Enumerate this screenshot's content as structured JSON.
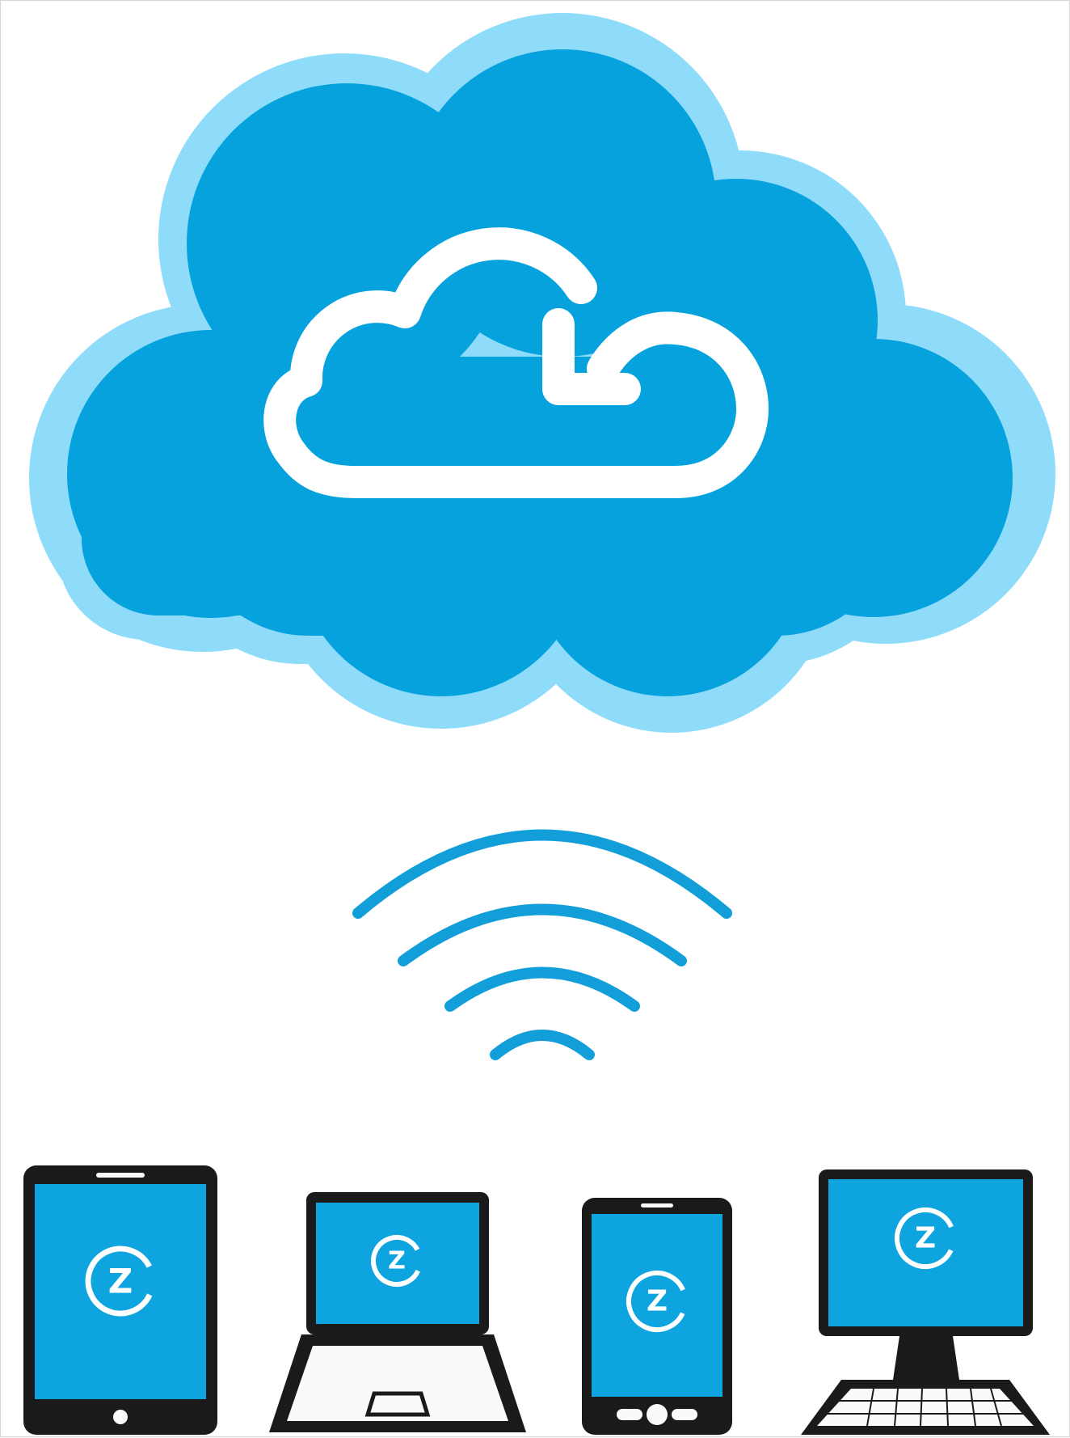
{
  "artwork": {
    "cloud": {
      "icon": "cloud-sync-icon",
      "outer_color": "#8fdcfa",
      "inner_color": "#05a2dd",
      "symbol_color": "#ffffff"
    },
    "wireless": {
      "icon": "wifi-signal-icon",
      "color": "#129fd9",
      "arc_count": 4
    },
    "devices": [
      {
        "kind": "tablet",
        "icon": "tablet-icon",
        "logo_letter": "Z"
      },
      {
        "kind": "laptop",
        "icon": "laptop-icon",
        "logo_letter": "Z"
      },
      {
        "kind": "phone",
        "icon": "smartphone-icon",
        "logo_letter": "Z"
      },
      {
        "kind": "desktop",
        "icon": "desktop-computer-icon",
        "logo_letter": "Z"
      }
    ],
    "colors": {
      "screen": "#0ea4df",
      "frame": "#1a1a1a",
      "background": "#ffffff"
    }
  }
}
